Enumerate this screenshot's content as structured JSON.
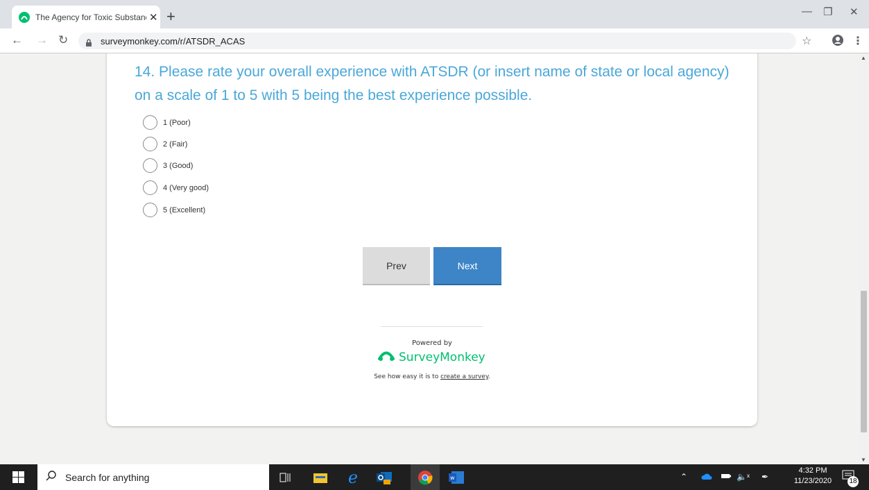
{
  "browser": {
    "tab_title": "The Agency for Toxic Substances",
    "tab_close": "✕",
    "new_tab": "+",
    "url": "surveymonkey.com/r/ATSDR_ACAS"
  },
  "survey": {
    "question": "14. Please rate your overall experience with ATSDR (or insert name of state or local agency) on a scale of 1 to 5 with 5 being the best experience possible.",
    "options": [
      "1 (Poor)",
      "2 (Fair)",
      "3 (Good)",
      "4 (Very good)",
      "5 (Excellent)"
    ],
    "prev_label": "Prev",
    "next_label": "Next",
    "powered_by": "Powered by",
    "brand": "SurveyMonkey",
    "see_how_prefix": "See how easy it is to ",
    "create_link": "create a survey",
    "see_how_suffix": "."
  },
  "taskbar": {
    "search_placeholder": "Search for anything",
    "time": "4:32 PM",
    "date": "11/23/2020",
    "notification_count": "18"
  },
  "colors": {
    "question": "#4aa7d9",
    "next_button": "#3d85c6",
    "brand_green": "#00bf6f"
  }
}
